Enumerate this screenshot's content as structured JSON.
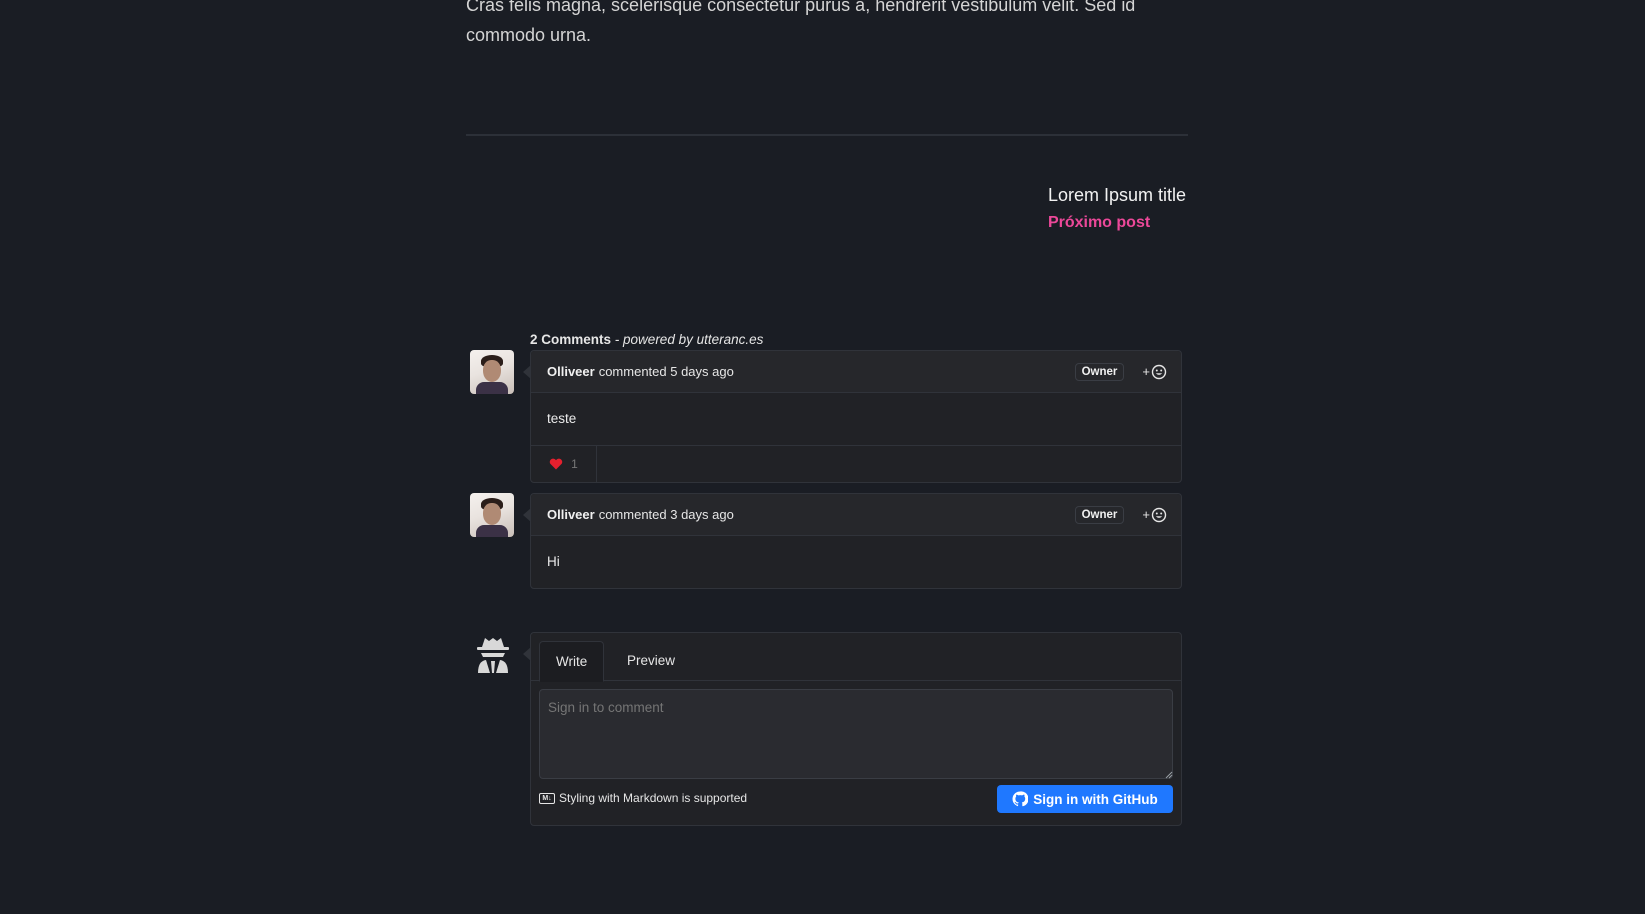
{
  "article": {
    "tail_text": "Cras felis magna, scelerisque consectetur purus a, hendrerit vestibulum velit. Sed id commodo urna."
  },
  "next_post": {
    "title": "Lorem Ipsum title",
    "link_label": "Próximo post"
  },
  "comments_section": {
    "count_label": "2 Comments",
    "powered_by": "- powered by utteranc.es",
    "comments": [
      {
        "author": "Olliveer",
        "meta": "commented 5 days ago",
        "badge": "Owner",
        "add_reaction_label": "+",
        "body": "teste",
        "reactions": [
          {
            "emoji": "heart-icon",
            "count": "1"
          }
        ]
      },
      {
        "author": "Olliveer",
        "meta": "commented 3 days ago",
        "badge": "Owner",
        "add_reaction_label": "+",
        "body": "Hi"
      }
    ],
    "editor": {
      "tabs": [
        "Write",
        "Preview"
      ],
      "placeholder": "Sign in to comment",
      "markdown_note": "Styling with Markdown is supported",
      "markdown_icon_text": "M↓",
      "signin_label": "Sign in with GitHub"
    }
  },
  "colors": {
    "background": "#1a1d24",
    "accent_link": "#ec4899",
    "button_blue": "#1f78ff",
    "heart": "#e5202e"
  }
}
